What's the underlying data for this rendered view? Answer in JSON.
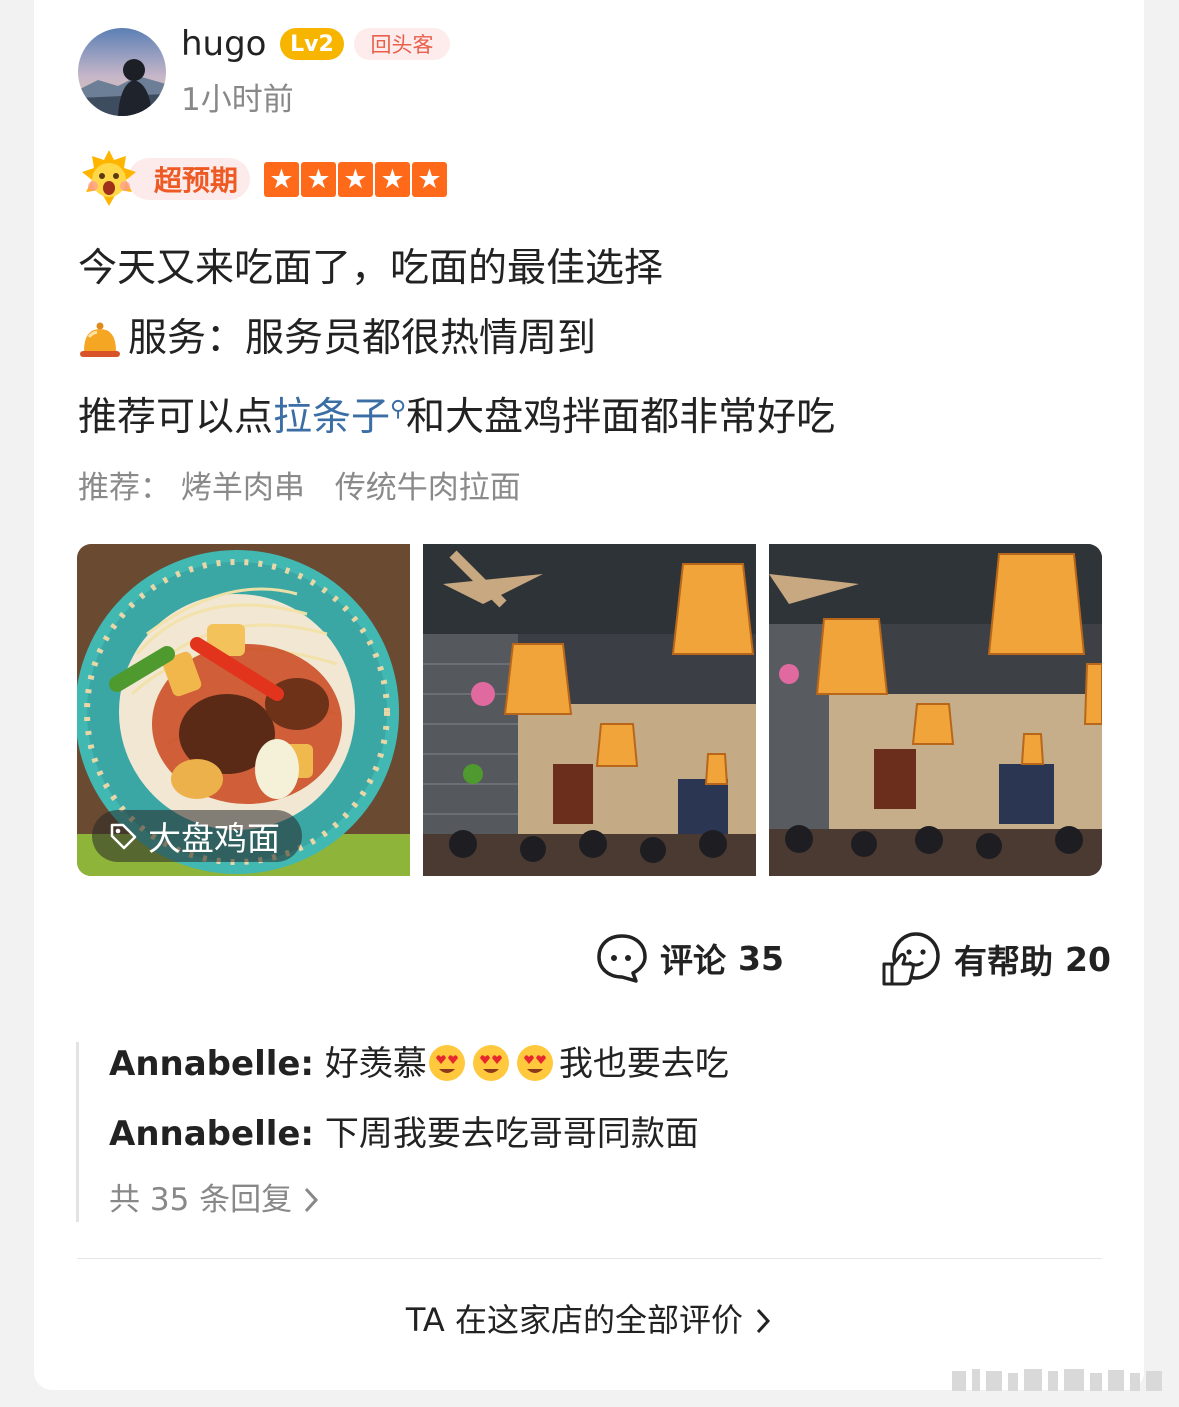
{
  "review": {
    "user": {
      "name": "hugo",
      "level": "Lv2",
      "badge": "回头客",
      "time": "1小时前"
    },
    "rating": {
      "mood_label": "超预期",
      "stars": 5,
      "star_color": "#ff6a1a"
    },
    "content": {
      "line1": "今天又来吃面了，吃面的最佳选择",
      "line2": "服务：服务员都很热情周到",
      "line3_prefix": "推荐可以点",
      "line3_link": "拉条子",
      "line3_suffix": "和大盘鸡拌面都非常好吃"
    },
    "recommend": {
      "label": "推荐：",
      "items": [
        "烤羊肉串",
        "传统牛肉拉面"
      ]
    },
    "photos": {
      "tag": "大盘鸡面",
      "items": [
        "photo-dapanji-noodles",
        "photo-restaurant-interior-1",
        "photo-restaurant-interior-2"
      ]
    },
    "actions": {
      "comments_label": "评论",
      "comments_count": "35",
      "helpful_label": "有帮助",
      "helpful_count": "20"
    },
    "replies": [
      {
        "author": "Annabelle:",
        "text_before": " 好羡慕",
        "emojis": 3,
        "text_after": "我也要去吃"
      },
      {
        "author": "Annabelle:",
        "text": " 下周我要去吃哥哥同款面"
      }
    ],
    "more_replies": "共 35 条回复",
    "all_reviews_link": "TA 在这家店的全部评价"
  },
  "colors": {
    "accent_orange": "#ff6a1a",
    "link_blue": "#3a6ea5",
    "level_gold": "#f7b500",
    "badge_red": "#e8604c"
  }
}
